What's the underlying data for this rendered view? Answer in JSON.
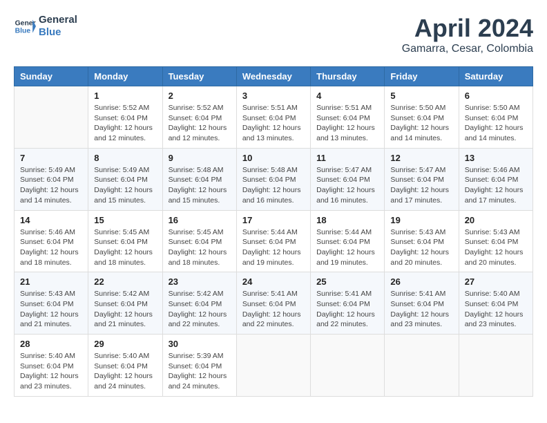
{
  "logo": {
    "line1": "General",
    "line2": "Blue"
  },
  "title": "April 2024",
  "location": "Gamarra, Cesar, Colombia",
  "days_of_week": [
    "Sunday",
    "Monday",
    "Tuesday",
    "Wednesday",
    "Thursday",
    "Friday",
    "Saturday"
  ],
  "weeks": [
    [
      {
        "day": "",
        "info": ""
      },
      {
        "day": "1",
        "info": "Sunrise: 5:52 AM\nSunset: 6:04 PM\nDaylight: 12 hours\nand 12 minutes."
      },
      {
        "day": "2",
        "info": "Sunrise: 5:52 AM\nSunset: 6:04 PM\nDaylight: 12 hours\nand 12 minutes."
      },
      {
        "day": "3",
        "info": "Sunrise: 5:51 AM\nSunset: 6:04 PM\nDaylight: 12 hours\nand 13 minutes."
      },
      {
        "day": "4",
        "info": "Sunrise: 5:51 AM\nSunset: 6:04 PM\nDaylight: 12 hours\nand 13 minutes."
      },
      {
        "day": "5",
        "info": "Sunrise: 5:50 AM\nSunset: 6:04 PM\nDaylight: 12 hours\nand 14 minutes."
      },
      {
        "day": "6",
        "info": "Sunrise: 5:50 AM\nSunset: 6:04 PM\nDaylight: 12 hours\nand 14 minutes."
      }
    ],
    [
      {
        "day": "7",
        "info": "Sunrise: 5:49 AM\nSunset: 6:04 PM\nDaylight: 12 hours\nand 14 minutes."
      },
      {
        "day": "8",
        "info": "Sunrise: 5:49 AM\nSunset: 6:04 PM\nDaylight: 12 hours\nand 15 minutes."
      },
      {
        "day": "9",
        "info": "Sunrise: 5:48 AM\nSunset: 6:04 PM\nDaylight: 12 hours\nand 15 minutes."
      },
      {
        "day": "10",
        "info": "Sunrise: 5:48 AM\nSunset: 6:04 PM\nDaylight: 12 hours\nand 16 minutes."
      },
      {
        "day": "11",
        "info": "Sunrise: 5:47 AM\nSunset: 6:04 PM\nDaylight: 12 hours\nand 16 minutes."
      },
      {
        "day": "12",
        "info": "Sunrise: 5:47 AM\nSunset: 6:04 PM\nDaylight: 12 hours\nand 17 minutes."
      },
      {
        "day": "13",
        "info": "Sunrise: 5:46 AM\nSunset: 6:04 PM\nDaylight: 12 hours\nand 17 minutes."
      }
    ],
    [
      {
        "day": "14",
        "info": "Sunrise: 5:46 AM\nSunset: 6:04 PM\nDaylight: 12 hours\nand 18 minutes."
      },
      {
        "day": "15",
        "info": "Sunrise: 5:45 AM\nSunset: 6:04 PM\nDaylight: 12 hours\nand 18 minutes."
      },
      {
        "day": "16",
        "info": "Sunrise: 5:45 AM\nSunset: 6:04 PM\nDaylight: 12 hours\nand 18 minutes."
      },
      {
        "day": "17",
        "info": "Sunrise: 5:44 AM\nSunset: 6:04 PM\nDaylight: 12 hours\nand 19 minutes."
      },
      {
        "day": "18",
        "info": "Sunrise: 5:44 AM\nSunset: 6:04 PM\nDaylight: 12 hours\nand 19 minutes."
      },
      {
        "day": "19",
        "info": "Sunrise: 5:43 AM\nSunset: 6:04 PM\nDaylight: 12 hours\nand 20 minutes."
      },
      {
        "day": "20",
        "info": "Sunrise: 5:43 AM\nSunset: 6:04 PM\nDaylight: 12 hours\nand 20 minutes."
      }
    ],
    [
      {
        "day": "21",
        "info": "Sunrise: 5:43 AM\nSunset: 6:04 PM\nDaylight: 12 hours\nand 21 minutes."
      },
      {
        "day": "22",
        "info": "Sunrise: 5:42 AM\nSunset: 6:04 PM\nDaylight: 12 hours\nand 21 minutes."
      },
      {
        "day": "23",
        "info": "Sunrise: 5:42 AM\nSunset: 6:04 PM\nDaylight: 12 hours\nand 22 minutes."
      },
      {
        "day": "24",
        "info": "Sunrise: 5:41 AM\nSunset: 6:04 PM\nDaylight: 12 hours\nand 22 minutes."
      },
      {
        "day": "25",
        "info": "Sunrise: 5:41 AM\nSunset: 6:04 PM\nDaylight: 12 hours\nand 22 minutes."
      },
      {
        "day": "26",
        "info": "Sunrise: 5:41 AM\nSunset: 6:04 PM\nDaylight: 12 hours\nand 23 minutes."
      },
      {
        "day": "27",
        "info": "Sunrise: 5:40 AM\nSunset: 6:04 PM\nDaylight: 12 hours\nand 23 minutes."
      }
    ],
    [
      {
        "day": "28",
        "info": "Sunrise: 5:40 AM\nSunset: 6:04 PM\nDaylight: 12 hours\nand 23 minutes."
      },
      {
        "day": "29",
        "info": "Sunrise: 5:40 AM\nSunset: 6:04 PM\nDaylight: 12 hours\nand 24 minutes."
      },
      {
        "day": "30",
        "info": "Sunrise: 5:39 AM\nSunset: 6:04 PM\nDaylight: 12 hours\nand 24 minutes."
      },
      {
        "day": "",
        "info": ""
      },
      {
        "day": "",
        "info": ""
      },
      {
        "day": "",
        "info": ""
      },
      {
        "day": "",
        "info": ""
      }
    ]
  ]
}
